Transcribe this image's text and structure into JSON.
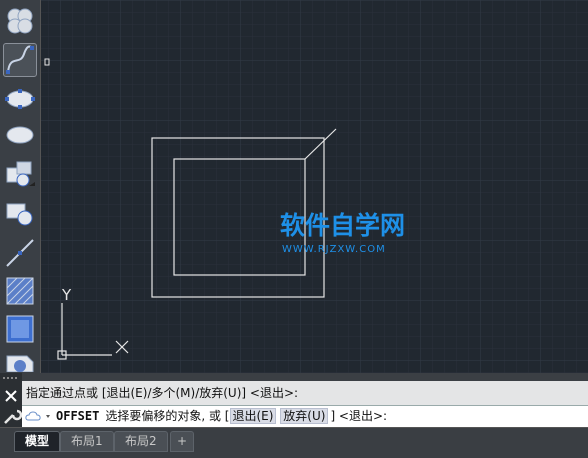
{
  "command_line": {
    "history_text": "指定通过点或 [退出(E)/多个(M)/放弃(U)] <退出>:",
    "command_name": "OFFSET",
    "prompt_text": "选择要偏移的对象, 或 [",
    "option_exit": "退出(E)",
    "option_undo": "放弃(U)",
    "prompt_tail": "] <退出>:"
  },
  "tabs": [
    {
      "label": "模型"
    },
    {
      "label": "布局1"
    },
    {
      "label": "布局2"
    }
  ],
  "add_tab_label": "+",
  "ucs": {
    "x_label": "X",
    "y_label": "Y"
  },
  "watermark": {
    "text": "软件自学网",
    "url": "WWW.RJZXW.COM",
    "color": "#1e90e8"
  },
  "colors": {
    "canvas": "#212830",
    "grid": "#2c3440",
    "lines": "#e6e6e6"
  },
  "icons": {
    "tools": [
      "revision-cloud-icon",
      "spline-icon",
      "ellipse-icon",
      "ellipse-arc-icon",
      "insert-block-icon",
      "make-block-icon",
      "point-icon",
      "hatch-icon",
      "gradient-icon",
      "region-icon"
    ],
    "close": "close-icon",
    "customize": "wrench-icon",
    "command": "command-prompt-icon"
  }
}
